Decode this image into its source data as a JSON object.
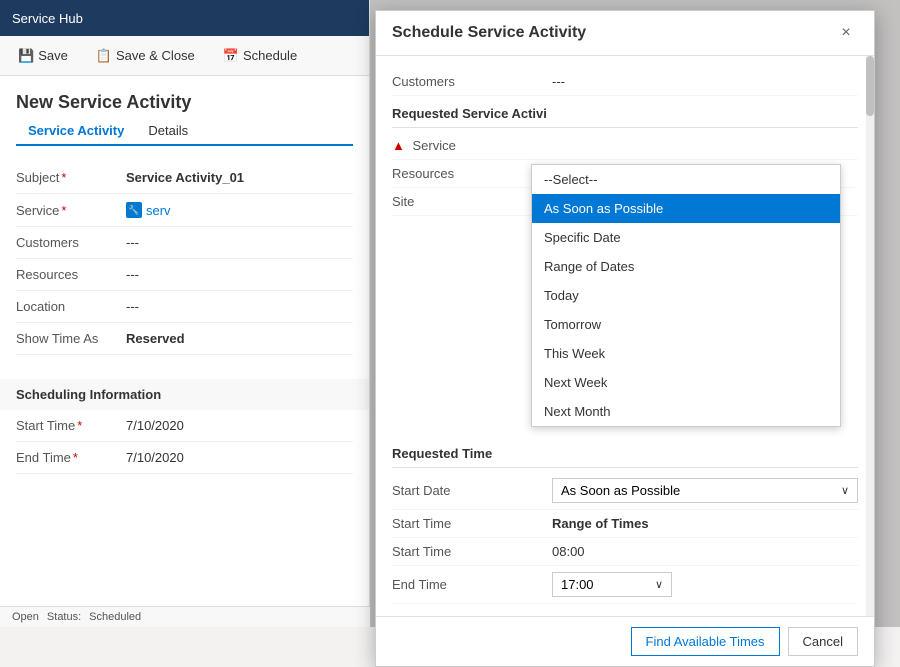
{
  "app": {
    "title": "Service Hub",
    "toolbar": {
      "save_label": "Save",
      "save_close_label": "Save & Close",
      "schedule_label": "Schedule"
    },
    "page_title": "New Service Activity",
    "tabs": [
      {
        "label": "Service Activity",
        "active": true
      },
      {
        "label": "Details",
        "active": false
      }
    ],
    "form_fields": [
      {
        "label": "Subject",
        "required": true,
        "value": "Service Activity_01",
        "bold": true
      },
      {
        "label": "Service",
        "required": true,
        "value": "serv",
        "type": "link"
      },
      {
        "label": "Customers",
        "required": false,
        "value": "---"
      },
      {
        "label": "Resources",
        "required": false,
        "value": "---"
      },
      {
        "label": "Location",
        "required": false,
        "value": "---"
      },
      {
        "label": "Show Time As",
        "required": false,
        "value": "Reserved",
        "bold": true
      }
    ],
    "scheduling_section": {
      "title": "Scheduling Information",
      "fields": [
        {
          "label": "Start Time",
          "required": true,
          "value": "7/10/2020"
        },
        {
          "label": "End Time",
          "required": true,
          "value": "7/10/2020"
        }
      ]
    },
    "status_bar": {
      "open_label": "Open",
      "status_label": "Status:",
      "status_value": "Scheduled"
    }
  },
  "modal": {
    "title": "Schedule Service Activity",
    "close_label": "×",
    "customers_label": "Customers",
    "customers_value": "---",
    "requested_section_title": "Requested Service Activi",
    "service_label": "Service",
    "resources_label": "Resources",
    "site_label": "Site",
    "requested_time_section": "Requested Time",
    "start_date_label": "Start Date",
    "start_date_value": "As Soon as Possible",
    "start_time_label": "Start Time",
    "start_time_value": "Range of Times",
    "start_time_field_label": "Start Time",
    "start_time_field_value": "08:00",
    "end_time_label": "End Time",
    "end_time_value": "17:00",
    "dropdown": {
      "items": [
        {
          "label": "--Select--",
          "selected": false
        },
        {
          "label": "As Soon as Possible",
          "selected": true
        },
        {
          "label": "Specific Date",
          "selected": false
        },
        {
          "label": "Range of Dates",
          "selected": false
        },
        {
          "label": "Today",
          "selected": false
        },
        {
          "label": "Tomorrow",
          "selected": false
        },
        {
          "label": "This Week",
          "selected": false
        },
        {
          "label": "Next Week",
          "selected": false
        },
        {
          "label": "Next Month",
          "selected": false
        }
      ]
    },
    "footer": {
      "find_times_label": "Find Available Times",
      "cancel_label": "Cancel"
    }
  }
}
